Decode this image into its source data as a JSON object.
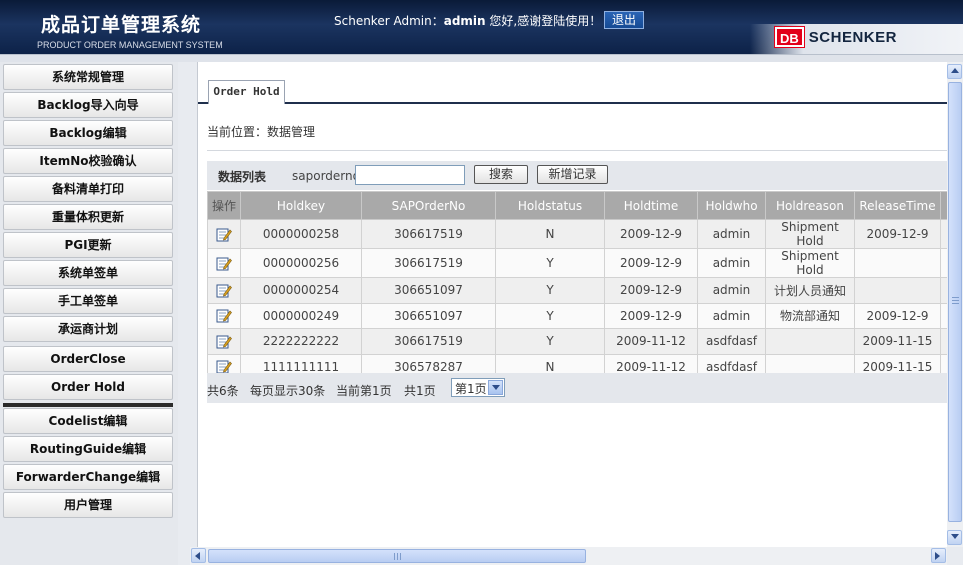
{
  "header": {
    "title": "成品订单管理系统",
    "subtitle": "PRODUCT ORDER MANAGEMENT SYSTEM",
    "user_prefix": "Schenker Admin：",
    "user_name": "admin",
    "user_suffix": " 您好,感谢登陆使用！",
    "logout_label": "退出",
    "brand_db": "DB",
    "brand_name": "SCHENKER"
  },
  "sidebar": {
    "items": [
      {
        "label": "系统常规管理"
      },
      {
        "label": "Backlog导入向导"
      },
      {
        "label": "Backlog编辑"
      },
      {
        "label": "ItemNo校验确认"
      },
      {
        "label": "备料清单打印"
      },
      {
        "label": "重量体积更新"
      },
      {
        "label": "PGI更新"
      },
      {
        "label": "系统单签单"
      },
      {
        "label": "手工单签单"
      },
      {
        "label": "承运商计划"
      },
      {
        "label": "OrderClose"
      },
      {
        "label": "Order Hold"
      },
      {
        "label": "Codelist编辑"
      },
      {
        "label": "RoutingGuide编辑"
      },
      {
        "label": "ForwarderChange编辑"
      },
      {
        "label": "用户管理"
      }
    ]
  },
  "main": {
    "tab_label": "Order Hold",
    "breadcrumb": "当前位置：数据管理",
    "toolbar": {
      "list_label": "数据列表",
      "field_label": "saporderno:",
      "field_value": "",
      "search_label": "搜索",
      "add_label": "新增记录"
    },
    "table": {
      "headers": [
        "操作",
        "Holdkey",
        "SAPOrderNo",
        "Holdstatus",
        "Holdtime",
        "Holdwho",
        "Holdreason",
        "ReleaseTime"
      ],
      "rows": [
        [
          "0000000258",
          "306617519",
          "N",
          "2009-12-9",
          "admin",
          "Shipment Hold",
          "2009-12-9"
        ],
        [
          "0000000256",
          "306617519",
          "Y",
          "2009-12-9",
          "admin",
          "Shipment Hold",
          ""
        ],
        [
          "0000000254",
          "306651097",
          "Y",
          "2009-12-9",
          "admin",
          "计划人员通知",
          ""
        ],
        [
          "0000000249",
          "306651097",
          "Y",
          "2009-12-9",
          "admin",
          "物流部通知",
          "2009-12-9"
        ],
        [
          "2222222222",
          "306617519",
          "Y",
          "2009-11-12",
          "asdfdasf",
          "",
          "2009-11-15"
        ],
        [
          "1111111111",
          "306578287",
          "N",
          "2009-11-12",
          "asdfdasf",
          "",
          "2009-11-15"
        ]
      ]
    },
    "pager": {
      "total": "共6条",
      "per_page": "每页显示30条",
      "current": "当前第1页",
      "pages": "共1页",
      "select_value": "第1页"
    }
  },
  "colors": {
    "header_bg": "#1b3460",
    "accent_red": "#e2001a",
    "table_header_bg": "#a9a9a9",
    "tab_underline": "#1f2f4c"
  }
}
